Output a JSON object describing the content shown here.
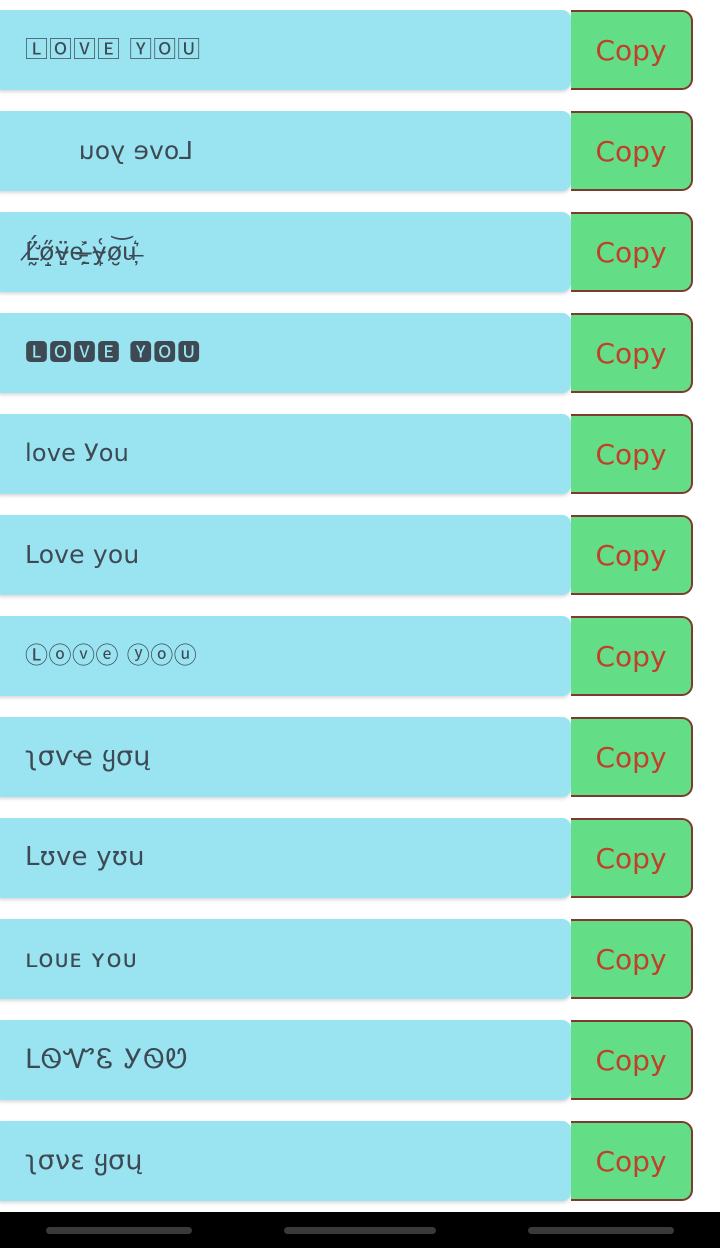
{
  "app": {
    "background_color": "#ffffff",
    "card_color": "#9ae4f2",
    "button_color": "#63de86",
    "button_border_color": "#7d3a2e",
    "button_text_color": "#c0412b",
    "text_color": "#3d4a54"
  },
  "button": {
    "copy_label": "Copy"
  },
  "rows": [
    {
      "id": "row-1",
      "style": "boxed",
      "text": "🄻🄾🅅🄴 🅈🄾🅄",
      "copy_label": "Copy"
    },
    {
      "id": "row-2",
      "style": "flip",
      "text": "Love you",
      "copy_label": "Copy"
    },
    {
      "id": "row-3",
      "style": "glitch",
      "text": "L̸̛̰̈́ő̷̝v̴̺̈e̵̗͐ ̶̱̇y̴̙͑o̷̮͝u̶̦͛",
      "copy_label": "Copy"
    },
    {
      "id": "row-4",
      "style": "negsq",
      "text": "🅻🅾🆅🅴 🆈🅾🆄",
      "copy_label": "Copy"
    },
    {
      "id": "row-5",
      "style": "mixed",
      "text": "love Уou",
      "copy_label": "Copy"
    },
    {
      "id": "row-6",
      "style": "plain",
      "text": "Love you",
      "copy_label": "Copy"
    },
    {
      "id": "row-7",
      "style": "circled",
      "text": "Ⓛⓞⓥⓔ ⓨⓞⓤ",
      "copy_label": "Copy"
    },
    {
      "id": "row-8",
      "style": "thai",
      "text": "ʅσѵҽ ყσų",
      "copy_label": "Copy"
    },
    {
      "id": "row-9",
      "style": "small",
      "text": "Lʊve yʊu",
      "copy_label": "Copy"
    },
    {
      "id": "row-10",
      "style": "smallcap",
      "text": "ʟᴏᴜᴇ ʏᴏᴜ",
      "copy_label": "Copy"
    },
    {
      "id": "row-11",
      "style": "cherokee",
      "text": "ᒪᏫᏉᏋ ᎩᏫᏬ",
      "copy_label": "Copy"
    },
    {
      "id": "row-12",
      "style": "script",
      "text": "ʅσνε ყσų",
      "copy_label": "Copy"
    }
  ],
  "navbar": {
    "background_color": "#000000",
    "buttons": [
      {
        "name": "back",
        "label": ""
      },
      {
        "name": "home",
        "label": ""
      },
      {
        "name": "recents",
        "label": ""
      }
    ]
  }
}
